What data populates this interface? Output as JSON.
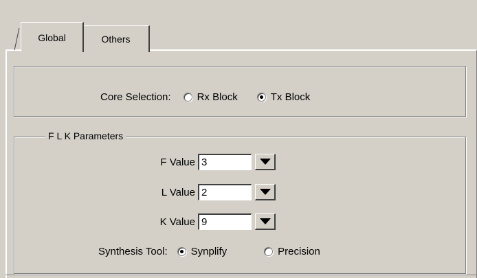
{
  "tabs": [
    {
      "label": "Global",
      "active": true
    },
    {
      "label": "Others",
      "active": false
    }
  ],
  "core": {
    "label": "Core Selection:",
    "options": [
      {
        "label": "Rx Block",
        "checked": false
      },
      {
        "label": "Tx Block",
        "checked": true
      }
    ]
  },
  "flk": {
    "legend": "F L K Parameters",
    "fields": [
      {
        "label": "F Value",
        "value": "3"
      },
      {
        "label": "L Value",
        "value": "2"
      },
      {
        "label": "K Value",
        "value": "9"
      }
    ],
    "synthesis": {
      "label": "Synthesis Tool:",
      "options": [
        {
          "label": "Synplify",
          "checked": true
        },
        {
          "label": "Precision",
          "checked": false
        }
      ]
    }
  },
  "icons": {
    "dropdown": "chevron-down-icon"
  }
}
